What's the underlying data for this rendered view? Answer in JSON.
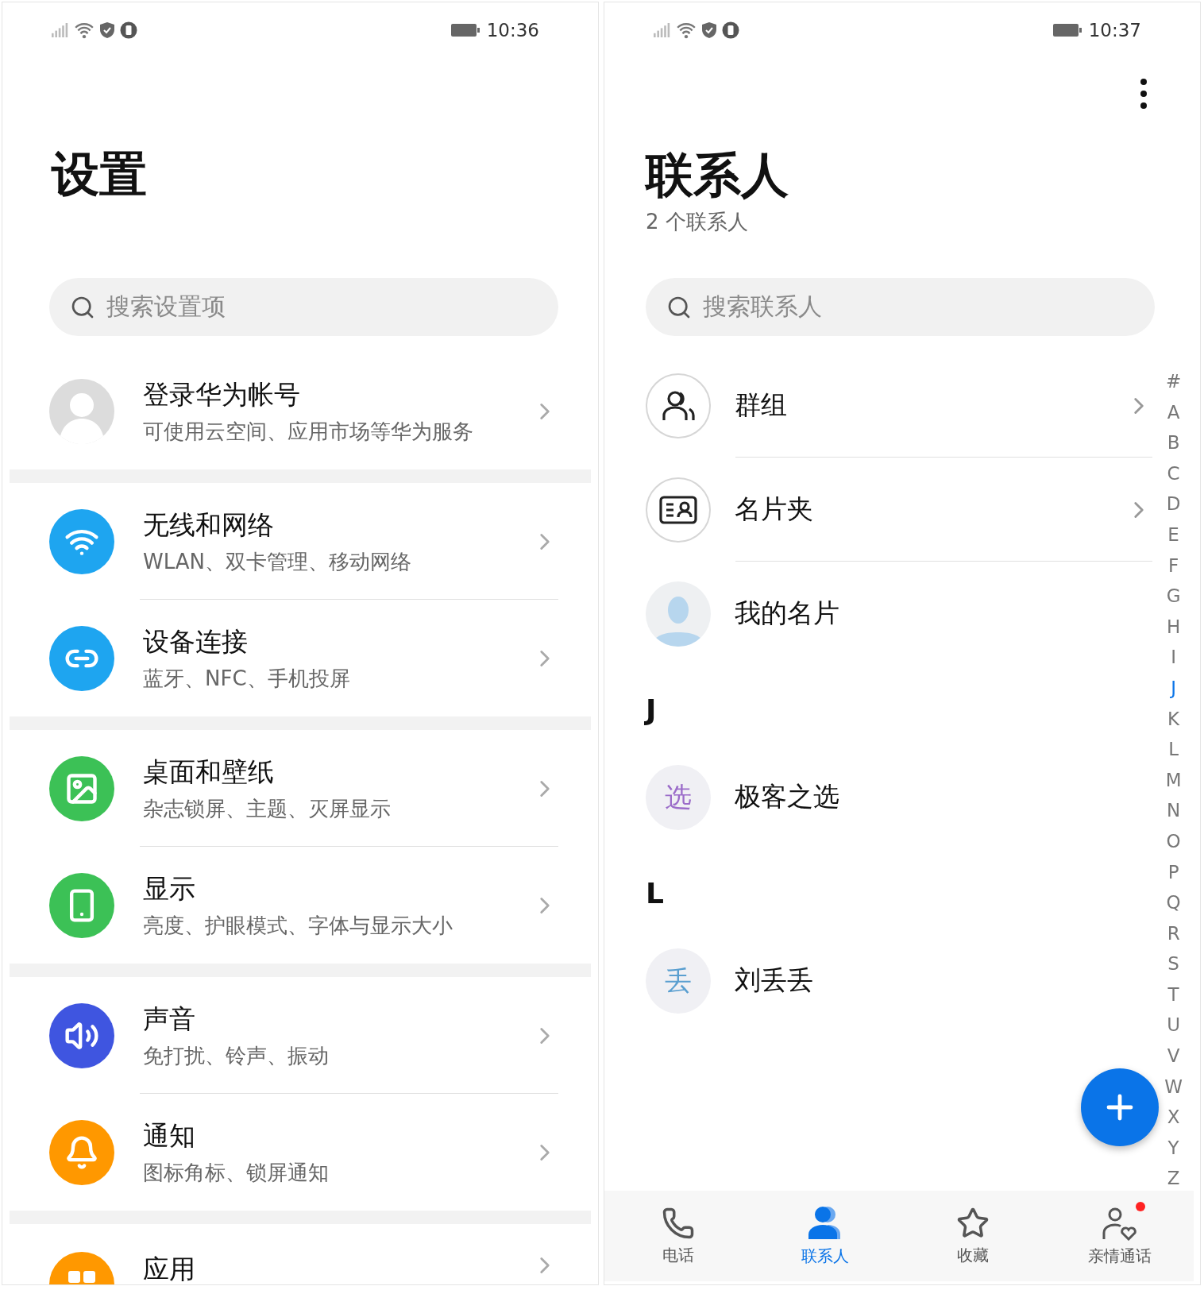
{
  "settings": {
    "status_bar": {
      "time": "10:36"
    },
    "title": "设置",
    "search": {
      "placeholder": "搜索设置项"
    },
    "groups": [
      [
        {
          "kind": "account",
          "title": "登录华为帐号",
          "subtitle": "可使用云空间、应用市场等华为服务"
        }
      ],
      [
        {
          "kind": "wifi",
          "color": "#1ea5f0",
          "title": "无线和网络",
          "subtitle": "WLAN、双卡管理、移动网络"
        },
        {
          "kind": "link",
          "color": "#1ea5f0",
          "title": "设备连接",
          "subtitle": "蓝牙、NFC、手机投屏"
        }
      ],
      [
        {
          "kind": "image",
          "color": "#3cc156",
          "title": "桌面和壁纸",
          "subtitle": "杂志锁屏、主题、灭屏显示"
        },
        {
          "kind": "phone",
          "color": "#3cc156",
          "title": "显示",
          "subtitle": "亮度、护眼模式、字体与显示大小"
        }
      ],
      [
        {
          "kind": "sound",
          "color": "#3f55e0",
          "title": "声音",
          "subtitle": "免打扰、铃声、振动"
        },
        {
          "kind": "bell",
          "color": "#ff9800",
          "title": "通知",
          "subtitle": "图标角标、锁屏通知"
        }
      ],
      [
        {
          "kind": "apps",
          "color": "#ff9800",
          "title": "应用"
        }
      ]
    ]
  },
  "contacts": {
    "status_bar": {
      "time": "10:37"
    },
    "title": "联系人",
    "subtitle": "2 个联系人",
    "search": {
      "placeholder": "搜索联系人"
    },
    "shortcuts": [
      {
        "kind": "groups",
        "label": "群组",
        "chevron": true
      },
      {
        "kind": "cards",
        "label": "名片夹",
        "chevron": true
      },
      {
        "kind": "profile",
        "label": "我的名片",
        "chevron": false
      }
    ],
    "sections": [
      {
        "letter": "J",
        "contacts": [
          {
            "name": "极客之选",
            "avatar_text": "选",
            "color": "#9b6cc9"
          }
        ]
      },
      {
        "letter": "L",
        "contacts": [
          {
            "name": "刘丢丢",
            "avatar_text": "丢",
            "color": "#5a9fd0"
          }
        ]
      }
    ],
    "index": [
      {
        "letter": "#",
        "selected": false
      },
      {
        "letter": "A",
        "selected": false
      },
      {
        "letter": "B",
        "selected": false
      },
      {
        "letter": "C",
        "selected": false
      },
      {
        "letter": "D",
        "selected": false
      },
      {
        "letter": "E",
        "selected": false
      },
      {
        "letter": "F",
        "selected": false
      },
      {
        "letter": "G",
        "selected": false
      },
      {
        "letter": "H",
        "selected": false
      },
      {
        "letter": "I",
        "selected": false
      },
      {
        "letter": "J",
        "selected": true
      },
      {
        "letter": "K",
        "selected": false
      },
      {
        "letter": "L",
        "selected": false
      },
      {
        "letter": "M",
        "selected": false
      },
      {
        "letter": "N",
        "selected": false
      },
      {
        "letter": "O",
        "selected": false
      },
      {
        "letter": "P",
        "selected": false
      },
      {
        "letter": "Q",
        "selected": false
      },
      {
        "letter": "R",
        "selected": false
      },
      {
        "letter": "S",
        "selected": false
      },
      {
        "letter": "T",
        "selected": false
      },
      {
        "letter": "U",
        "selected": false
      },
      {
        "letter": "V",
        "selected": false
      },
      {
        "letter": "W",
        "selected": false
      },
      {
        "letter": "X",
        "selected": false
      },
      {
        "letter": "Y",
        "selected": false
      },
      {
        "letter": "Z",
        "selected": false
      }
    ],
    "nav": [
      {
        "kind": "phone",
        "label": "电话",
        "selected": false,
        "badge": false
      },
      {
        "kind": "contacts",
        "label": "联系人",
        "selected": true,
        "badge": false
      },
      {
        "kind": "star",
        "label": "收藏",
        "selected": false,
        "badge": false
      },
      {
        "kind": "family",
        "label": "亲情通话",
        "selected": false,
        "badge": true
      }
    ]
  }
}
